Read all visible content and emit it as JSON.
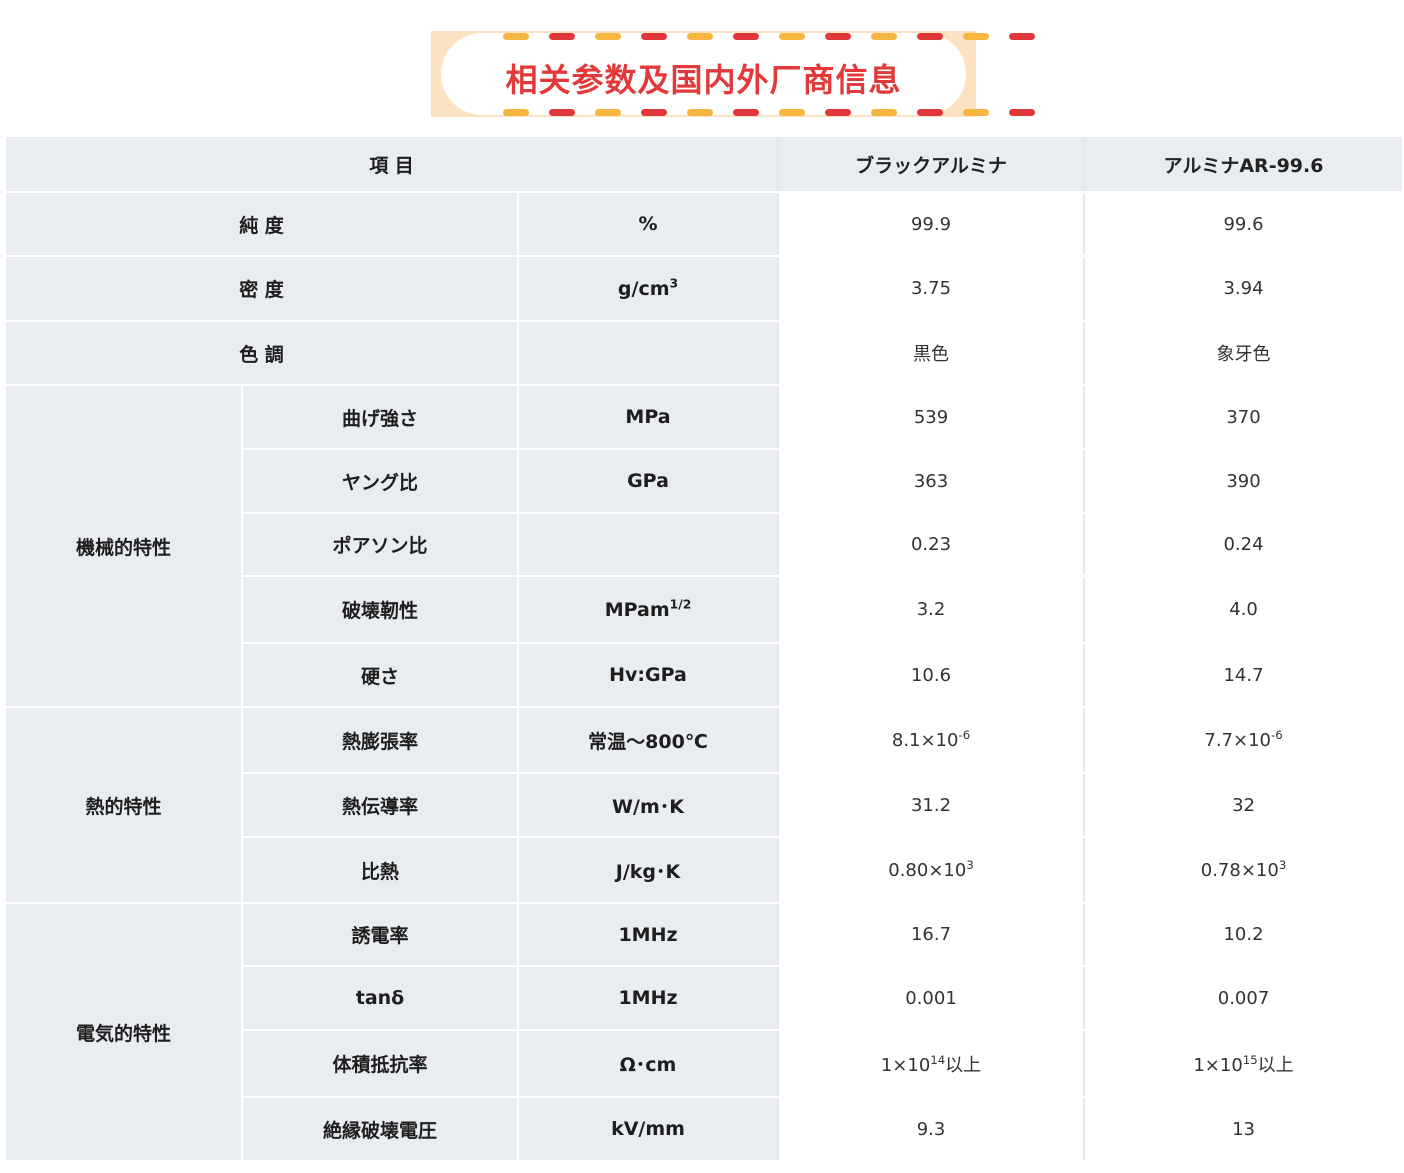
{
  "banner": {
    "title": "相关参数及国内外厂商信息"
  },
  "header": {
    "item": "項 目",
    "col1": "ブラックアルミナ",
    "col2": "アルミナAR-99.6"
  },
  "rows": {
    "purity": {
      "label": "純 度",
      "unit": "%",
      "v1": "99.9",
      "v2": "99.6"
    },
    "density": {
      "label": "密 度",
      "unit_base": "g/cm",
      "unit_sup": "3",
      "v1": "3.75",
      "v2": "3.94"
    },
    "color": {
      "label": "色 調",
      "unit": "",
      "v1": "黒色",
      "v2": "象牙色"
    }
  },
  "groups": {
    "mechanical": {
      "label": "機械的特性"
    },
    "thermal": {
      "label": "熱的特性"
    },
    "electrical": {
      "label": "電気的特性"
    }
  },
  "mechanical": {
    "bend": {
      "label": "曲げ強さ",
      "unit": "MPa",
      "v1": "539",
      "v2": "370"
    },
    "young": {
      "label": "ヤング比",
      "unit": "GPa",
      "v1": "363",
      "v2": "390"
    },
    "poisson": {
      "label": "ポアソン比",
      "unit": "",
      "v1": "0.23",
      "v2": "0.24"
    },
    "fracture": {
      "label": "破壊靭性",
      "unit_base": "MPam",
      "unit_sup": "1/2",
      "v1": "3.2",
      "v2": "4.0"
    },
    "hardness": {
      "label": "硬さ",
      "unit": "Hv:GPa",
      "v1": "10.6",
      "v2": "14.7"
    }
  },
  "thermal": {
    "expansion": {
      "label": "熱膨張率",
      "unit": "常温～800℃",
      "v1_base": "8.1×10",
      "v1_sup": "-6",
      "v2_base": "7.7×10",
      "v2_sup": "-6"
    },
    "conductivity": {
      "label": "熱伝導率",
      "unit": "W/m･K",
      "v1": "31.2",
      "v2": "32"
    },
    "specific": {
      "label": "比熱",
      "unit": "J/kg･K",
      "v1_base": "0.80×10",
      "v1_sup": "3",
      "v2_base": "0.78×10",
      "v2_sup": "3"
    }
  },
  "electrical": {
    "permittivity": {
      "label": "誘電率",
      "unit": "1MHz",
      "v1": "16.7",
      "v2": "10.2"
    },
    "tan": {
      "label": "tanδ",
      "unit": "1MHz",
      "v1": "0.001",
      "v2": "0.007"
    },
    "resistivity": {
      "label": "体積抵抗率",
      "unit": "Ω･cm",
      "v1_base": "1×10",
      "v1_sup": "14",
      "v1_tail": "以上",
      "v2_base": "1×10",
      "v2_sup": "15",
      "v2_tail": "以上"
    },
    "breakdown": {
      "label": "絶縁破壊電圧",
      "unit": "kV/mm",
      "v1": "9.3",
      "v2": "13"
    }
  },
  "colors": {
    "accent": "#e23a3a",
    "banner_bg": "#fbe3c2",
    "dash_yellow": "#f6b640",
    "label_bg": "#e9edf1"
  }
}
